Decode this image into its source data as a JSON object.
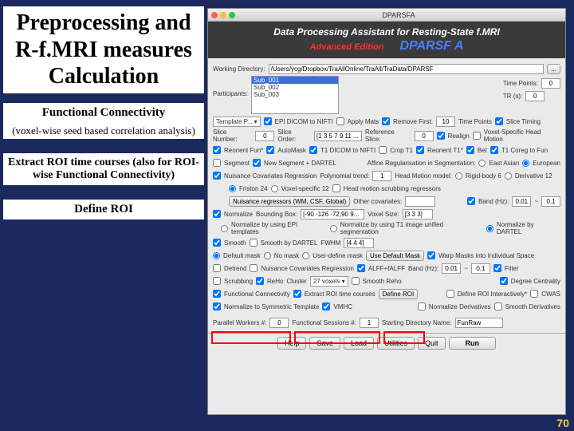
{
  "slide": {
    "title": "Preprocessing and R-f.MRI measures Calculation",
    "sub1_title": "Functional Connectivity",
    "sub1_text": "(voxel-wise seed based correlation analysis)",
    "sub2": "Extract ROI time courses (also for ROI-wise Functional Connectivity)",
    "sub3": "Define ROI",
    "pagenum": "70"
  },
  "window": {
    "title": "DPARSFA",
    "header_title": "Data Processing Assistant for Resting-State f.MRI",
    "adv": "Advanced Edition",
    "brand": "DPARSF A"
  },
  "wd": {
    "label": "Working Directory:",
    "value": "/Users/ycg/Dropbox/TraAllOnline/TraAll/TraData/DPARSF",
    "btn": "..."
  },
  "participants": {
    "label": "Participants:",
    "items": [
      "Sub_001",
      "Sub_002",
      "Sub_003"
    ],
    "tp_label": "Time Points:",
    "tp": "0",
    "tr_label": "TR (s):",
    "tr": "0"
  },
  "r1": {
    "template": "Template P...",
    "epi": "EPI DICOM to NIFTI",
    "apply": "Apply Mats",
    "remfirst": "Remove First:",
    "remval": "10",
    "tp": "Time Points",
    "slice": "Slice Timing"
  },
  "r2": {
    "sn": "Slice Number:",
    "snv": "0",
    "so": "Slice Order:",
    "sov": "[1 3 5 7 9 11 ...",
    "rs": "Reference Slice:",
    "rsv": "0",
    "realign": "Realign",
    "voxhm": "Voxel-Specific Head Motion"
  },
  "r3": {
    "reorient": "Reorient Fun*",
    "automask": "AutoMask",
    "t1dicom": "T1 DICOM to NIFTI",
    "crop": "Crop T1",
    "reorientt1": "Reorient T1*",
    "bet": "Bet",
    "coreg": "T1 Coreg to Fun"
  },
  "r4": {
    "seg": "Segment",
    "newseg": "New Segment + DARTEL",
    "affine": "Affine Regularisation in Segmentation:",
    "east": "East Asian",
    "euro": "European"
  },
  "r5": {
    "nuis": "Nuisance Covariates Regression",
    "poly": "Polynomial trend:",
    "polyv": "1",
    "hm": "Head Motion model:",
    "rigid": "Rigid-body 6",
    "deriv": "Derivative 12"
  },
  "r6": {
    "friston": "Friston 24",
    "voxspec": "Voxel-specific 12",
    "scrub": "Head motion scrubbing regressors"
  },
  "r7": {
    "nr": "Nuisance regressors (WM, CSF, Global)",
    "other": "Other covariates:",
    "bp": "Band (Hz):",
    "lo": "0.01",
    "sep": "~",
    "hi": "0.1"
  },
  "r8": {
    "norm": "Normalize",
    "bb": "Bounding Box:",
    "bbv": "[-90 -126 -72;90 9...",
    "vs": "Voxel Size:",
    "vsv": "[3 3 3]"
  },
  "r9": {
    "epi": "Normalize by using EPI templates",
    "t1": "Normalize by using T1 image unified segmentation",
    "dartel": "Normalize by DARTEL"
  },
  "r10": {
    "smooth": "Smooth",
    "dartel": "Smooth by DARTEL",
    "fwhm": "FWHM",
    "fwhmv": "[4 4 4]"
  },
  "r11": {
    "def": "Default mask",
    "no": "No mask",
    "user": "User-define mask",
    "usebtn": "Use Default Mask",
    "warp": "Warp Masks into Individual Space"
  },
  "r12": {
    "detrend": "Detrend",
    "nuis": "Nuisance Covariates Regression",
    "alff": "ALFF+fALFF",
    "band": "Band (Hz):",
    "lo": "0.01",
    "sep": "~",
    "hi": "0.1",
    "filter": "Filter"
  },
  "r13": {
    "scrub": "Scrubbing",
    "reho": "ReHo",
    "cluster": "Cluster",
    "clusterv": "27 voxels",
    "sreho": "Smooth Reho",
    "dc": "Degree Centrality"
  },
  "r14": {
    "fc": "Functional Connectivity",
    "extract": "Extract ROI time courses",
    "defroi": "Define ROI",
    "defroi2": "Define ROI Interactively*",
    "cwas": "CWAS"
  },
  "r15": {
    "norm": "Normalize to Symmetric Template",
    "vmhc": "VMHC",
    "normderiv": "Normalize Derivatives",
    "smderiv": "Smooth Derivatives"
  },
  "r16": {
    "pw": "Parallel Workers #:",
    "pwv": "0",
    "fs": "Functional Sessions #:",
    "fsv": "1",
    "sd": "Starting Directory Name:",
    "sdv": "FunRaw"
  },
  "buttons": {
    "help": "Help",
    "save": "Save",
    "load": "Load",
    "util": "Utilities",
    "quit": "Quit",
    "run": "Run"
  }
}
